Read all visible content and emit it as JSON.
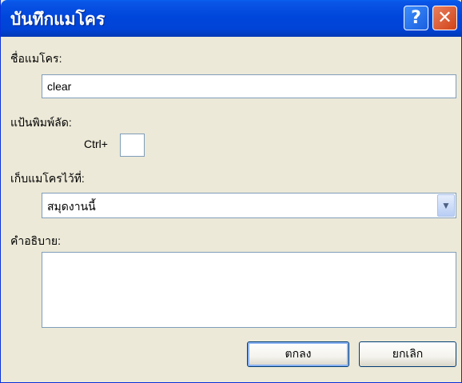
{
  "window": {
    "title": "บันทึกแมโคร"
  },
  "title_buttons": {
    "help": "?",
    "close": "✕"
  },
  "form": {
    "macro_name_label": "ชื่อแมโคร:",
    "macro_name_value": "clear",
    "shortcut_label": "แป้นพิมพ์ลัด:",
    "shortcut_prefix": "Ctrl+",
    "shortcut_value": "",
    "store_in_label": "เก็บแมโครไว้ที่:",
    "store_in_value": "สมุดงานนี้",
    "description_label": "คำอธิบาย:",
    "description_value": ""
  },
  "buttons": {
    "ok": "ตกลง",
    "cancel": "ยกเลิก"
  },
  "colors": {
    "titlebar": "#0046dc",
    "dialog_bg": "#ece9d8",
    "field_border": "#7f9db9"
  },
  "icons": {
    "dropdown": "chevron-down-icon"
  }
}
